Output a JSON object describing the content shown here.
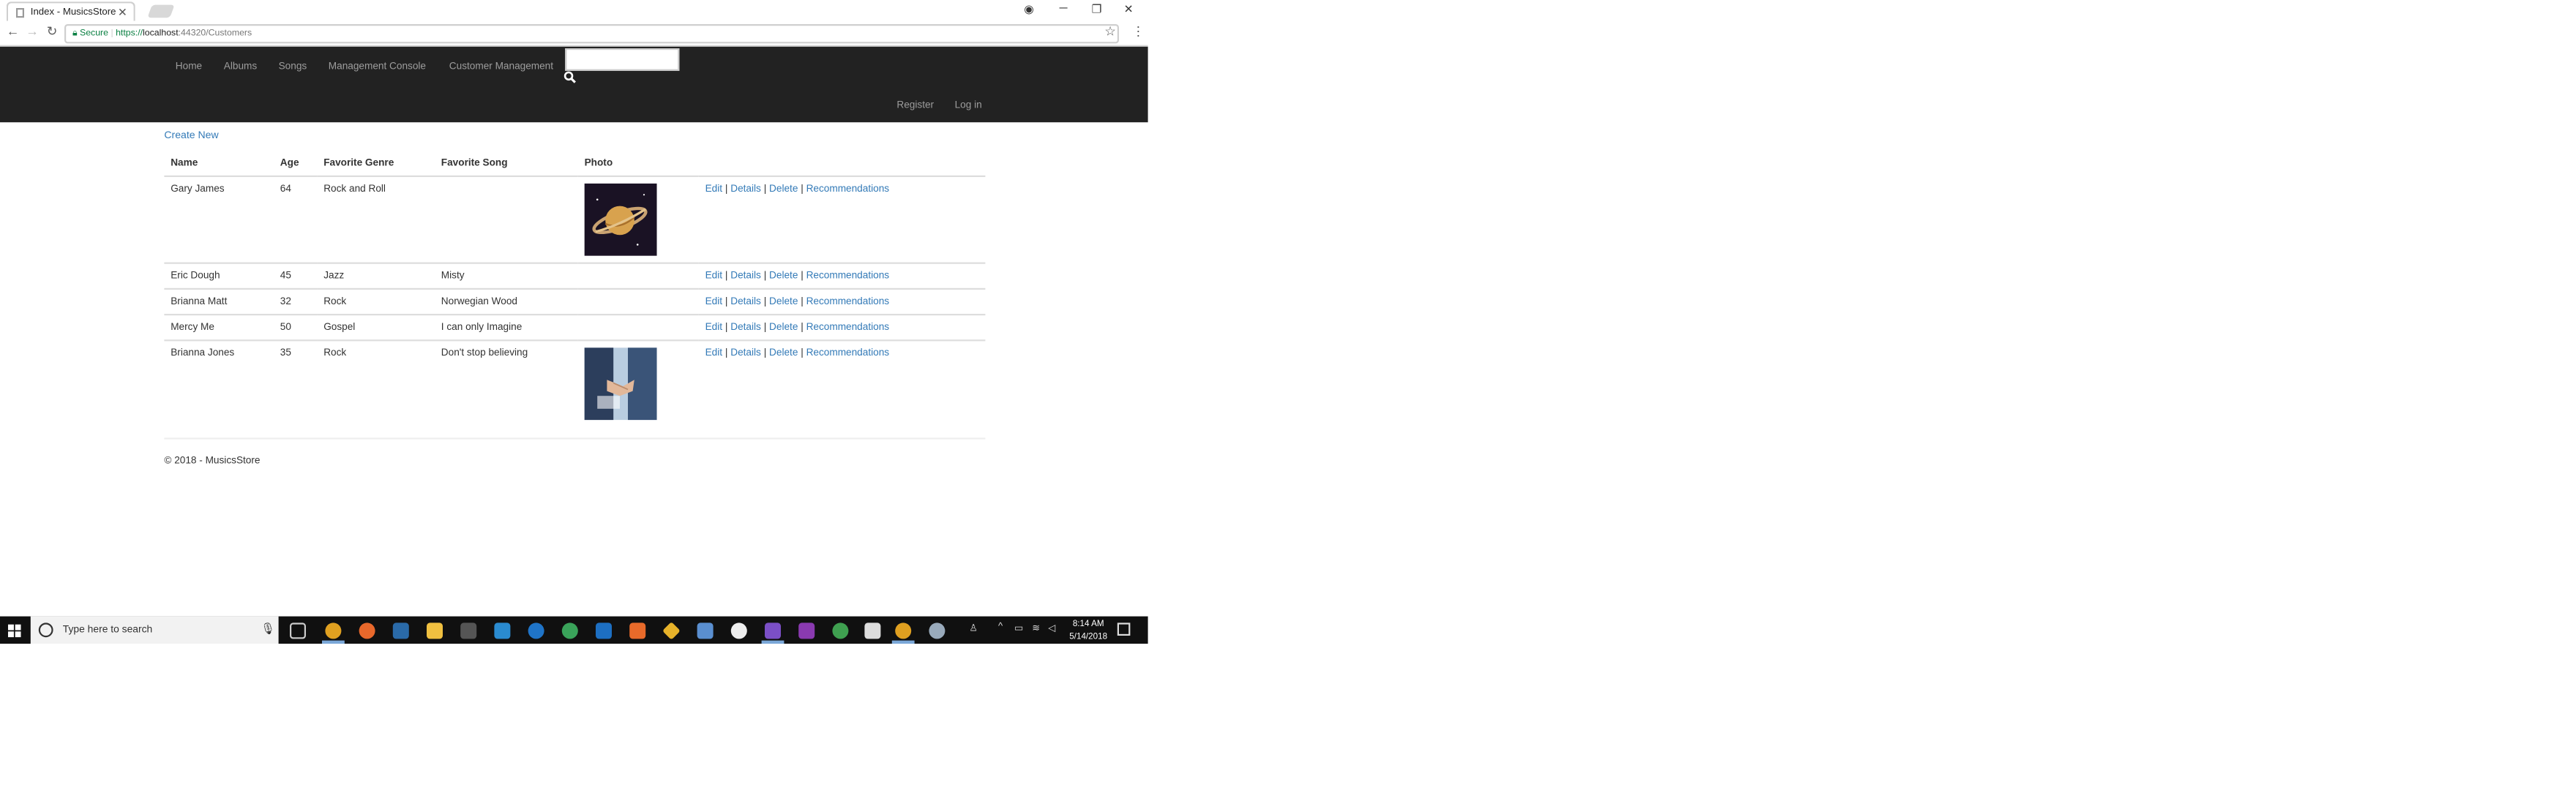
{
  "browser": {
    "tab_title": "Index - MusicsStore",
    "url_secure_label": "Secure",
    "url_scheme": "https://",
    "url_host": "localhost",
    "url_path": ":44320/Customers"
  },
  "nav": {
    "links": [
      "Home",
      "Albums",
      "Songs",
      "Management Console",
      "Customer Management"
    ],
    "search_placeholder": "",
    "register": "Register",
    "login": "Log in"
  },
  "page": {
    "create_new": "Create New",
    "columns": [
      "Name",
      "Age",
      "Favorite Genre",
      "Favorite Song",
      "Photo"
    ],
    "rows": [
      {
        "name": "Gary James",
        "age": "64",
        "genre": "Rock and Roll",
        "song": "",
        "photo": "saturn-planet-image"
      },
      {
        "name": "Eric Dough",
        "age": "45",
        "genre": "Jazz",
        "song": "Misty",
        "photo": ""
      },
      {
        "name": "Brianna Matt",
        "age": "32",
        "genre": "Rock",
        "song": "Norwegian Wood",
        "photo": ""
      },
      {
        "name": "Mercy Me",
        "age": "50",
        "genre": "Gospel",
        "song": "I can only Imagine",
        "photo": ""
      },
      {
        "name": "Brianna Jones",
        "age": "35",
        "genre": "Rock",
        "song": "Don't stop believing",
        "photo": "handshake-image"
      }
    ],
    "actions": {
      "edit": "Edit",
      "details": "Details",
      "delete": "Delete",
      "recommendations": "Recommendations"
    },
    "footer": "© 2018 - MusicsStore"
  },
  "taskbar": {
    "search_placeholder": "Type here to search",
    "time": "8:14 AM",
    "date": "5/14/2018"
  },
  "colors": {
    "navbar": "#222222",
    "link": "#337ab7",
    "nav_text": "#9d9d9d",
    "taskbar": "#101010"
  }
}
